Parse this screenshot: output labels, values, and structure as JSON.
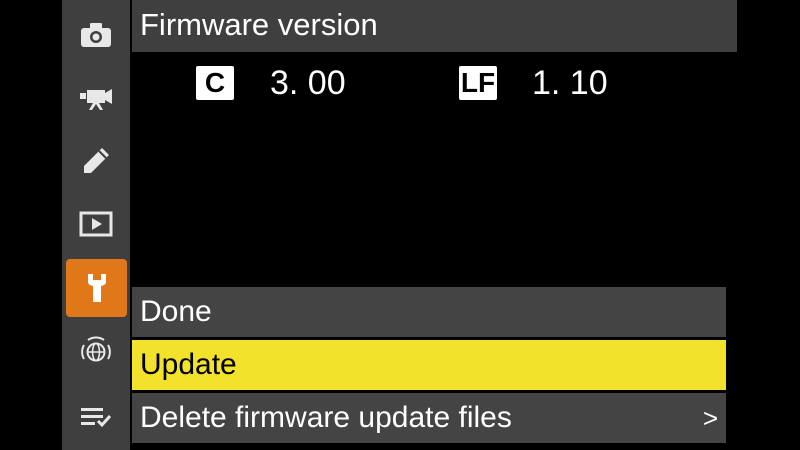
{
  "title": "Firmware version",
  "firmware": [
    {
      "badge": "C",
      "value": "3. 00"
    },
    {
      "badge": "LF",
      "value": "1. 10"
    }
  ],
  "rail": [
    {
      "icon": "camera-icon"
    },
    {
      "icon": "movie-camera-icon"
    },
    {
      "icon": "pencil-icon"
    },
    {
      "icon": "playback-icon"
    },
    {
      "icon": "wrench-icon",
      "active": true
    },
    {
      "icon": "network-globe-icon"
    },
    {
      "icon": "my-menu-icon"
    }
  ],
  "menu": [
    {
      "label": "Done"
    },
    {
      "label": "Update",
      "selected": true
    },
    {
      "label": "Delete firmware update files",
      "chevron": ">"
    }
  ],
  "colors": {
    "rail_bg": "#3f3f3f",
    "active_tab": "#e0781a",
    "selected_row": "#f2e22b",
    "row_bg": "#444444"
  }
}
